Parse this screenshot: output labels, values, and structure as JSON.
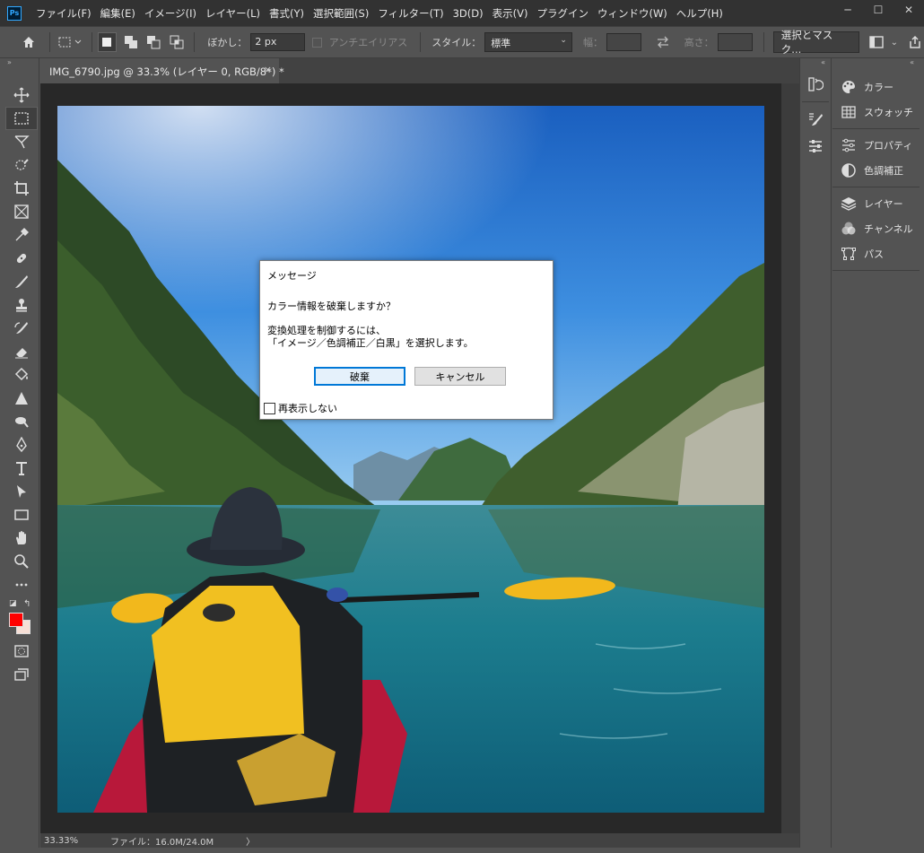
{
  "menubar": {
    "logo": "Ps",
    "items": [
      "ファイル(F)",
      "編集(E)",
      "イメージ(I)",
      "レイヤー(L)",
      "書式(Y)",
      "選択範囲(S)",
      "フィルター(T)",
      "3D(D)",
      "表示(V)",
      "プラグイン",
      "ウィンドウ(W)",
      "ヘルプ(H)"
    ],
    "window_controls": [
      "─",
      "☐",
      "✕"
    ]
  },
  "options": {
    "feather_label": "ぼかし：",
    "feather_value": "2 px",
    "antialias_label": "アンチエイリアス",
    "style_label": "スタイル：",
    "style_value": "標準",
    "width_label": "幅：",
    "height_label": "高さ：",
    "select_mask_button": "選択とマスク..."
  },
  "document": {
    "tab_title": "IMG_6790.jpg @ 33.3% (レイヤー 0, RGB/8*) *",
    "tab_close": "×"
  },
  "status": {
    "zoom": "33.33%",
    "file_info": "ファイル：16.0M/24.0M",
    "arrow": "〉"
  },
  "panels": {
    "group1": [
      "カラー",
      "スウォッチ"
    ],
    "group2": [
      "プロパティ",
      "色調補正"
    ],
    "group3": [
      "レイヤー",
      "チャンネル",
      "パス"
    ]
  },
  "dialog": {
    "title": "メッセージ",
    "question": "カラー情報を破棄しますか？",
    "line1": "変換処理を制御するには、",
    "line2": "「イメージ／色調補正／白黒」を選択します。",
    "discard_button": "破棄",
    "cancel_button": "キャンセル",
    "dont_show_label": "再表示しない"
  },
  "colors": {
    "foreground": "#ff0000",
    "background": "#f6ded5",
    "accent": "#0078d7"
  }
}
